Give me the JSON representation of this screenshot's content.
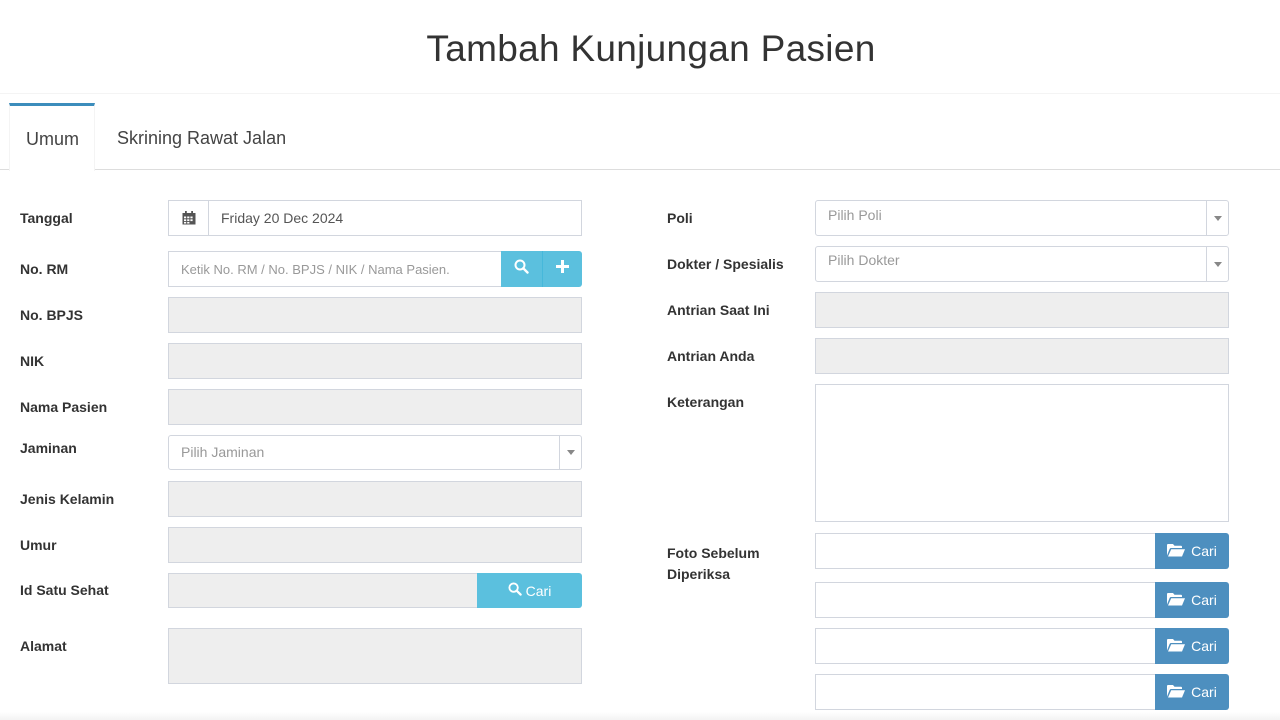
{
  "page": {
    "title": "Tambah Kunjungan Pasien"
  },
  "tabs": [
    {
      "label": "Umum",
      "active": true
    },
    {
      "label": "Skrining Rawat Jalan",
      "active": false
    }
  ],
  "left_form": {
    "tanggal": {
      "label": "Tanggal",
      "value": "Friday 20 Dec 2024",
      "icon": "calendar-icon"
    },
    "no_rm": {
      "label": "No. RM",
      "placeholder": "Ketik No. RM / No. BPJS / NIK / Nama Pasien.",
      "icons": [
        "search-icon",
        "plus-icon"
      ]
    },
    "no_bpjs": {
      "label": "No. BPJS",
      "value": ""
    },
    "nik": {
      "label": "NIK",
      "value": ""
    },
    "nama_pasien": {
      "label": "Nama Pasien",
      "value": ""
    },
    "jaminan": {
      "label": "Jaminan",
      "placeholder": "Pilih Jaminan"
    },
    "jenis_kelamin": {
      "label": "Jenis Kelamin",
      "value": ""
    },
    "umur": {
      "label": "Umur",
      "value": ""
    },
    "id_satu_sehat": {
      "label": "Id Satu Sehat",
      "value": "",
      "button_label": "Cari"
    },
    "alamat": {
      "label": "Alamat",
      "value": ""
    }
  },
  "right_form": {
    "poli": {
      "label": "Poli",
      "placeholder": "Pilih Poli"
    },
    "dokter": {
      "label": "Dokter / Spesialis",
      "placeholder": "Pilih Dokter"
    },
    "antrian_saat_ini": {
      "label": "Antrian Saat Ini",
      "value": ""
    },
    "antrian_anda": {
      "label": "Antrian Anda",
      "value": ""
    },
    "keterangan": {
      "label": "Keterangan",
      "value": ""
    },
    "foto": {
      "label_line1": "Foto Sebelum",
      "label_line2": "Diperiksa",
      "files": [
        {
          "value": "",
          "button_label": "Cari"
        },
        {
          "value": "",
          "button_label": "Cari"
        },
        {
          "value": "",
          "button_label": "Cari"
        },
        {
          "value": "",
          "button_label": "Cari"
        }
      ]
    }
  },
  "colors": {
    "info": "#5bc0de",
    "primary": "#4d8fbf",
    "readonly": "#eeeeee",
    "accent": "#3c8dbc"
  }
}
